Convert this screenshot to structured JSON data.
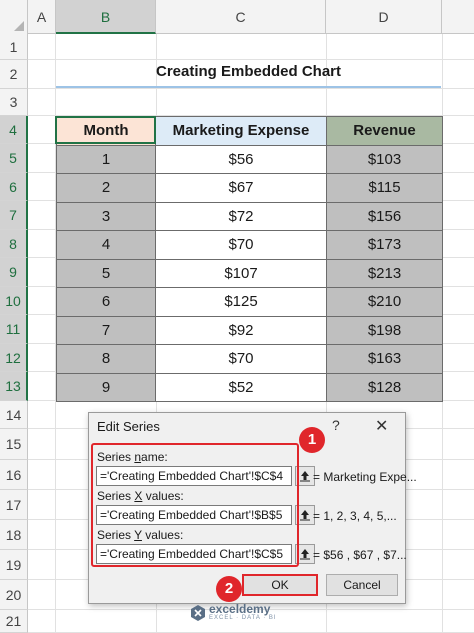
{
  "sheet": {
    "columns": [
      "A",
      "B",
      "C",
      "D"
    ],
    "rows": [
      "1",
      "2",
      "3",
      "4",
      "5",
      "6",
      "7",
      "8",
      "9",
      "10",
      "11",
      "12",
      "13",
      "14",
      "15",
      "16",
      "17",
      "18",
      "19",
      "20",
      "21"
    ],
    "title": "Creating Embedded Chart",
    "table": {
      "headers": [
        "Month",
        "Marketing Expense",
        "Revenue"
      ],
      "rows": [
        [
          "1",
          "$56",
          "$103"
        ],
        [
          "2",
          "$67",
          "$115"
        ],
        [
          "3",
          "$72",
          "$156"
        ],
        [
          "4",
          "$70",
          "$173"
        ],
        [
          "5",
          "$107",
          "$213"
        ],
        [
          "6",
          "$125",
          "$210"
        ],
        [
          "7",
          "$92",
          "$198"
        ],
        [
          "8",
          "$70",
          "$163"
        ],
        [
          "9",
          "$52",
          "$128"
        ]
      ]
    }
  },
  "dialog": {
    "title": "Edit Series",
    "help": "?",
    "close": "✕",
    "series_name": {
      "label_pre": "Series ",
      "label_u": "n",
      "label_post": "ame:",
      "value": "='Creating Embedded Chart'!$C$4",
      "preview": "= Marketing Expe..."
    },
    "x_values": {
      "label_pre": "Series ",
      "label_u": "X",
      "label_post": " values:",
      "value": "='Creating Embedded Chart'!$B$5",
      "preview": "= 1, 2, 3, 4, 5,..."
    },
    "y_values": {
      "label_pre": "Series ",
      "label_u": "Y",
      "label_post": " values:",
      "value": "='Creating Embedded Chart'!$C$5",
      "preview": "= $56 , $67 , $7..."
    },
    "ok_label": "OK",
    "cancel_label": "Cancel"
  },
  "badges": {
    "one": "1",
    "two": "2"
  },
  "watermark": {
    "name": "exceldemy",
    "tagline": "EXCEL · DATA · BI"
  },
  "colors": {
    "excel_green": "#217346",
    "annotation_red": "#e0262b"
  }
}
